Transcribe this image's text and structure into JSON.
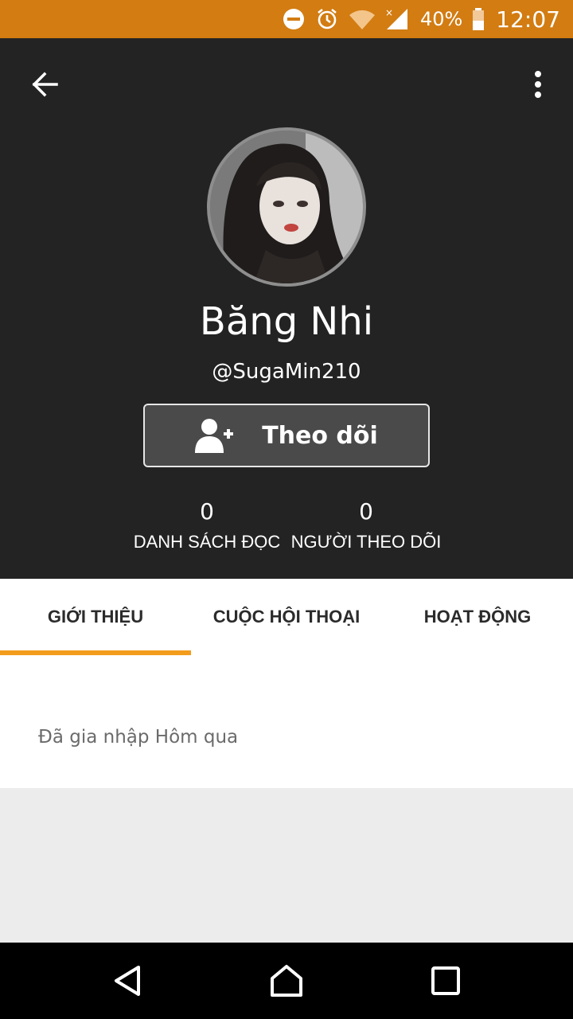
{
  "status_bar": {
    "battery": "40%",
    "time": "12:07",
    "icons": [
      "do-not-disturb-icon",
      "alarm-icon",
      "wifi-icon",
      "signal-icon",
      "battery-icon"
    ],
    "bar_color": "#d27c12"
  },
  "toolbar": {
    "back_icon": "arrow-left-icon",
    "more_icon": "more-vertical-icon"
  },
  "profile": {
    "display_name": "Băng Nhi",
    "username": "@SugaMin210",
    "follow_button": "Theo dõi",
    "follow_icon": "add-person-icon"
  },
  "stats": [
    {
      "count": "0",
      "label": "DANH SÁCH ĐỌC"
    },
    {
      "count": "0",
      "label": "NGƯỜI THEO DÕI"
    }
  ],
  "tabs": [
    {
      "label": "GIỚI THIỆU",
      "active": true
    },
    {
      "label": "CUỘC HỘI THOẠI",
      "active": false
    },
    {
      "label": "HOẠT ĐỘNG",
      "active": false
    }
  ],
  "about": {
    "joined_text": "Đã gia nhập Hôm qua"
  },
  "nav": [
    "back-triangle-icon",
    "home-icon",
    "recents-square-icon"
  ],
  "colors": {
    "header_bg": "#232323",
    "accent": "#f39c1c",
    "follow_bg": "#4a4a4a"
  }
}
